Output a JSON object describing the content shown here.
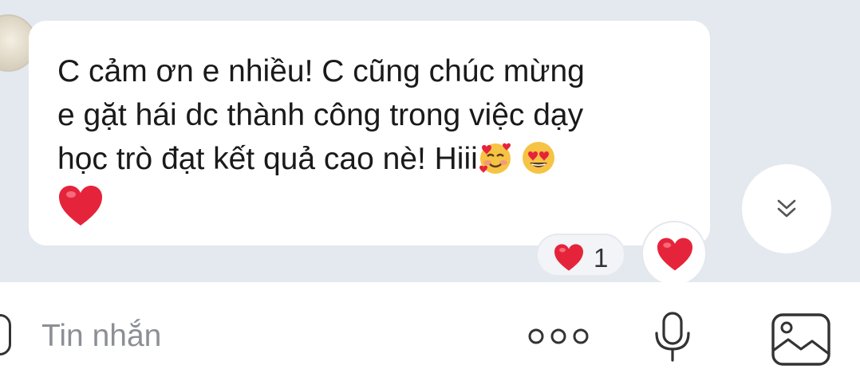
{
  "message": {
    "line1": "C cảm ơn e nhiều! C cũng chúc mừng",
    "line2": "e gặt hái dc thành công trong việc dạy",
    "line3": "học trò đạt kết quả cao nè! Hiii",
    "emojis": [
      "smiling-face-with-hearts",
      "heart-eyes",
      "red-heart"
    ]
  },
  "reaction": {
    "icon": "red-heart",
    "count": "1"
  },
  "composer": {
    "placeholder": "Tin nhắn"
  },
  "colors": {
    "background": "#e4e8ef",
    "bubble": "#ffffff",
    "heart": "#e5243b"
  }
}
